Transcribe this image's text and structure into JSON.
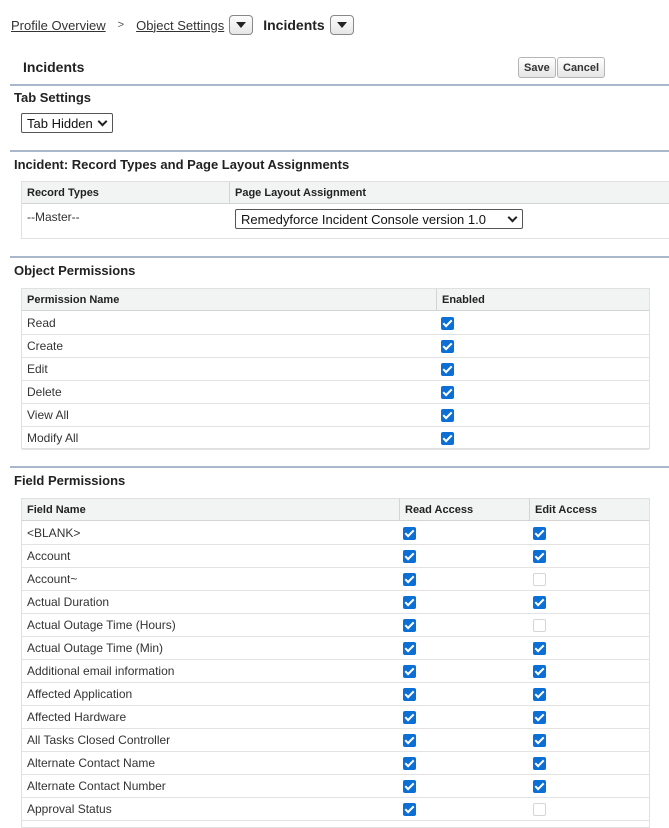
{
  "breadcrumb": {
    "profile_overview": "Profile Overview",
    "separator": ">",
    "object_settings": "Object Settings",
    "current": "Incidents"
  },
  "header": {
    "title": "Incidents",
    "save_label": "Save",
    "cancel_label": "Cancel"
  },
  "tab_settings": {
    "title": "Tab Settings",
    "selected": "Tab Hidden"
  },
  "record_types": {
    "title": "Incident: Record Types and Page Layout Assignments",
    "col_record_types": "Record Types",
    "col_page_layout": "Page Layout Assignment",
    "row_record_type": "--Master--",
    "row_layout_selected": "Remedyforce Incident Console version 1.0"
  },
  "object_permissions": {
    "title": "Object Permissions",
    "col_name": "Permission Name",
    "col_enabled": "Enabled",
    "rows": [
      {
        "name": "Read",
        "enabled": true
      },
      {
        "name": "Create",
        "enabled": true
      },
      {
        "name": "Edit",
        "enabled": true
      },
      {
        "name": "Delete",
        "enabled": true
      },
      {
        "name": "View All",
        "enabled": true
      },
      {
        "name": "Modify All",
        "enabled": true
      }
    ]
  },
  "field_permissions": {
    "title": "Field Permissions",
    "col_field": "Field Name",
    "col_read": "Read Access",
    "col_edit": "Edit Access",
    "rows": [
      {
        "name": "<BLANK>",
        "read": true,
        "edit": true
      },
      {
        "name": "Account",
        "read": true,
        "edit": true
      },
      {
        "name": "Account~",
        "read": true,
        "edit": false
      },
      {
        "name": "Actual Duration",
        "read": true,
        "edit": true
      },
      {
        "name": "Actual Outage Time (Hours)",
        "read": true,
        "edit": false
      },
      {
        "name": "Actual Outage Time (Min)",
        "read": true,
        "edit": true
      },
      {
        "name": "Additional email information",
        "read": true,
        "edit": true
      },
      {
        "name": "Affected Application",
        "read": true,
        "edit": true
      },
      {
        "name": "Affected Hardware",
        "read": true,
        "edit": true
      },
      {
        "name": "All Tasks Closed Controller",
        "read": true,
        "edit": true
      },
      {
        "name": "Alternate Contact Name",
        "read": true,
        "edit": true
      },
      {
        "name": "Alternate Contact Number",
        "read": true,
        "edit": true
      },
      {
        "name": "Approval Status",
        "read": true,
        "edit": false
      }
    ]
  },
  "colors": {
    "checkbox_checked": "#0b6fd6",
    "section_rule": "#a8b7c9",
    "header_bg": "#f2f3f3"
  }
}
